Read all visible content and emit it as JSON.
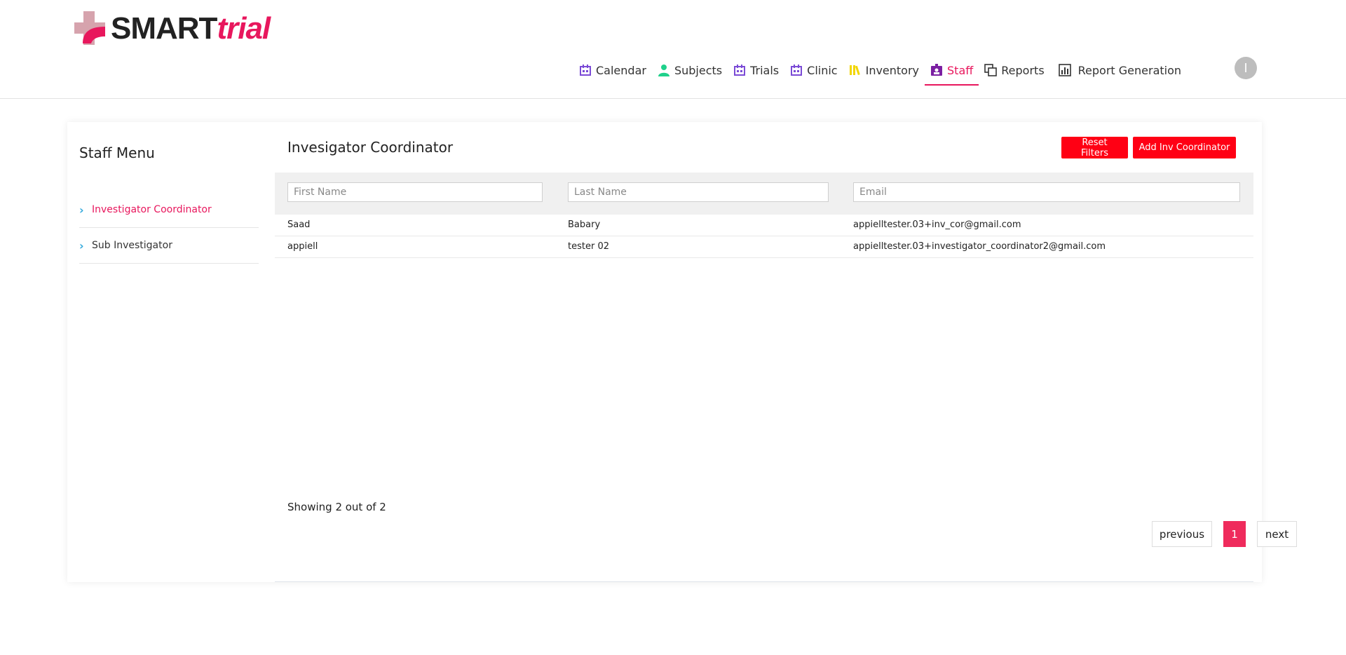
{
  "brand": {
    "smart": "SMART",
    "trial": "trial",
    "accent": "#e8175d"
  },
  "nav": [
    {
      "label": "Calendar",
      "icon": "calendar-icon"
    },
    {
      "label": "Subjects",
      "icon": "person-icon"
    },
    {
      "label": "Trials",
      "icon": "trials-icon"
    },
    {
      "label": "Clinic",
      "icon": "clinic-icon"
    },
    {
      "label": "Inventory",
      "icon": "inventory-icon"
    },
    {
      "label": "Staff",
      "icon": "staff-icon",
      "active": true
    },
    {
      "label": "Reports",
      "icon": "reports-icon"
    },
    {
      "label": "Report Generation",
      "icon": "report-generation-icon"
    }
  ],
  "avatar": {
    "initial": "I"
  },
  "sidebar": {
    "title": "Staff Menu",
    "items": [
      {
        "label": "Investigator Coordinator",
        "active": true
      },
      {
        "label": "Sub Investigator",
        "active": false
      }
    ]
  },
  "main": {
    "title": "Invesigator Coordinator",
    "reset_label": "Reset Filters",
    "add_label": "Add Inv Coordinator",
    "filters": {
      "first_placeholder": "First Name",
      "last_placeholder": "Last Name",
      "email_placeholder": "Email"
    },
    "rows": [
      {
        "first": "Saad",
        "last": "Babary",
        "email": "appielltester.03+inv_cor@gmail.com"
      },
      {
        "first": "appiell",
        "last": "tester 02",
        "email": "appielltester.03+investigator_coordinator2@gmail.com"
      }
    ],
    "showing": "Showing 2 out of 2",
    "pagination": {
      "previous": "previous",
      "page": "1",
      "next": "next"
    }
  }
}
